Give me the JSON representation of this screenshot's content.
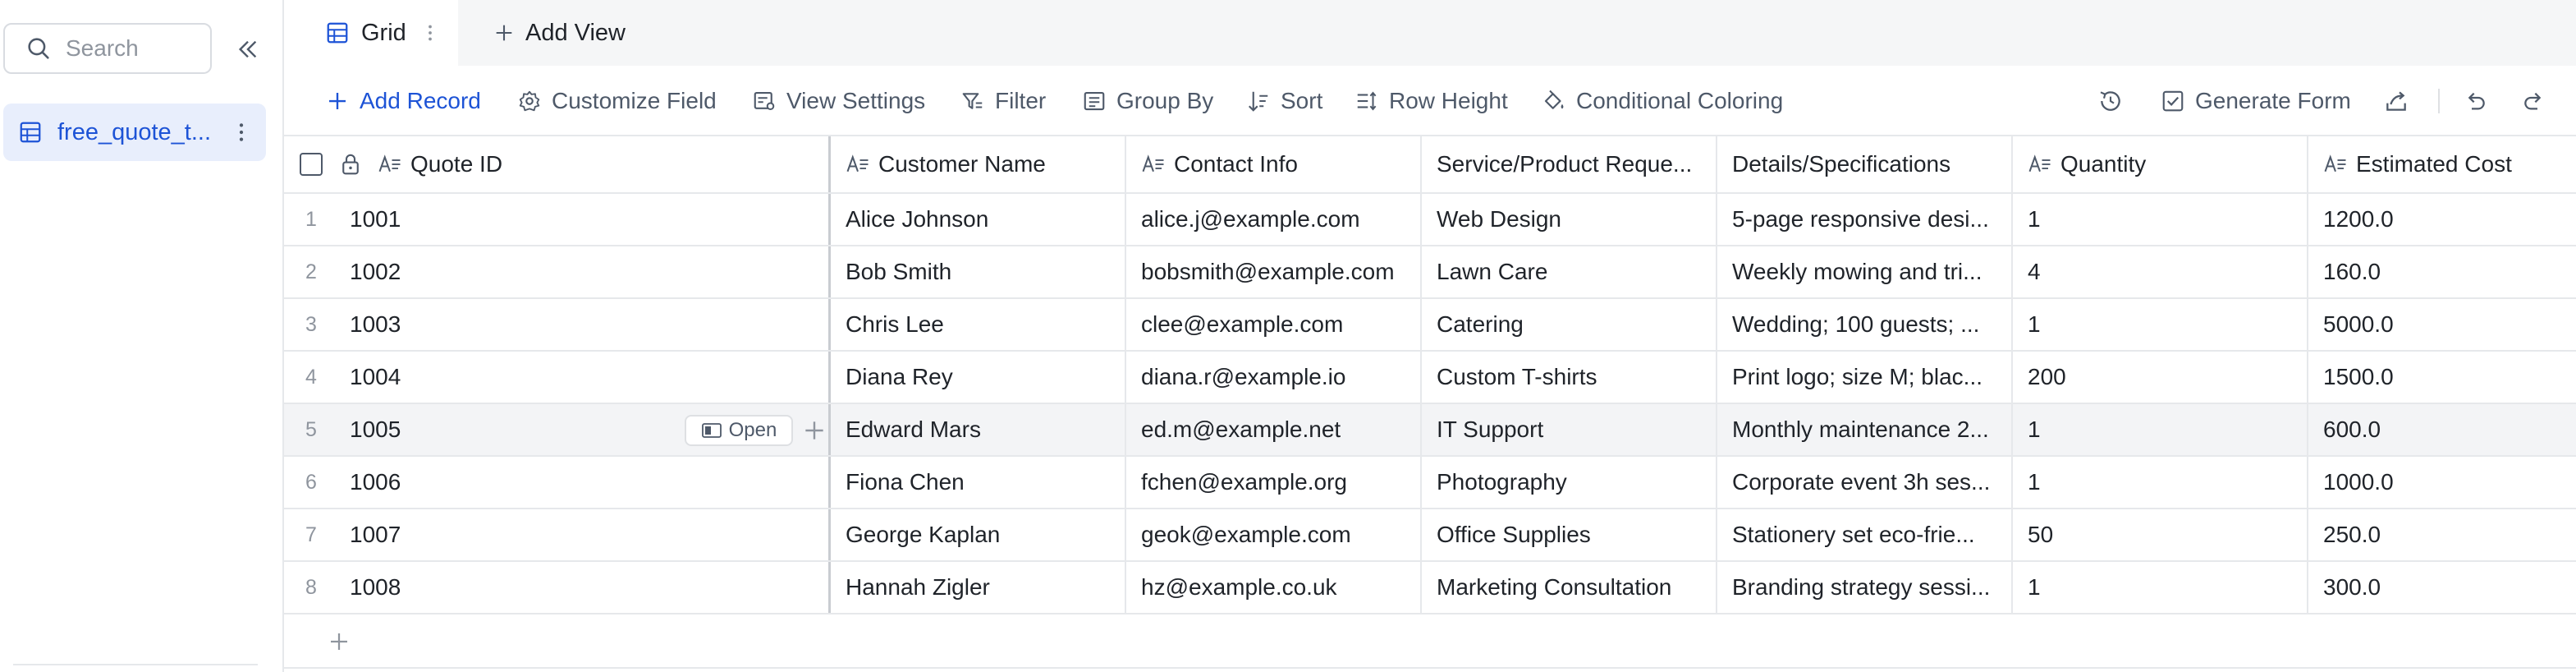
{
  "sidebar": {
    "search": {
      "placeholder": "Search",
      "value": ""
    },
    "items": [
      {
        "label": "free_quote_t..."
      }
    ]
  },
  "views": {
    "tabs": [
      {
        "label": "Grid"
      }
    ],
    "add_view_label": "Add View"
  },
  "toolbar": {
    "add_record": "Add Record",
    "customize_field": "Customize Field",
    "view_settings": "View Settings",
    "filter": "Filter",
    "group_by": "Group By",
    "sort": "Sort",
    "row_height": "Row Height",
    "conditional_coloring": "Conditional Coloring",
    "generate_form": "Generate Form"
  },
  "table": {
    "columns": [
      {
        "label": "Quote ID",
        "icon": "text-field-icon"
      },
      {
        "label": "Customer Name",
        "icon": "text-field-icon"
      },
      {
        "label": "Contact Info",
        "icon": "text-field-icon"
      },
      {
        "label": "Service/Product Reque...",
        "icon": ""
      },
      {
        "label": "Details/Specifications",
        "icon": ""
      },
      {
        "label": "Quantity",
        "icon": "text-field-icon"
      },
      {
        "label": "Estimated Cost",
        "icon": "text-field-icon"
      }
    ],
    "rows": [
      {
        "num": "1",
        "cells": [
          "1001",
          "Alice Johnson",
          "alice.j@example.com",
          "Web Design",
          "5-page responsive desi...",
          "1",
          "1200.0"
        ]
      },
      {
        "num": "2",
        "cells": [
          "1002",
          "Bob Smith",
          "bobsmith@example.com",
          "Lawn Care",
          "Weekly mowing and tri...",
          "4",
          "160.0"
        ]
      },
      {
        "num": "3",
        "cells": [
          "1003",
          "Chris Lee",
          "clee@example.com",
          "Catering",
          "Wedding; 100 guests; ...",
          "1",
          "5000.0"
        ]
      },
      {
        "num": "4",
        "cells": [
          "1004",
          "Diana Rey",
          "diana.r@example.io",
          "Custom T-shirts",
          "Print logo; size M; blac...",
          "200",
          "1500.0"
        ]
      },
      {
        "num": "5",
        "cells": [
          "1005",
          "Edward Mars",
          "ed.m@example.net",
          "IT Support",
          "Monthly maintenance 2...",
          "1",
          "600.0"
        ]
      },
      {
        "num": "6",
        "cells": [
          "1006",
          "Fiona Chen",
          "fchen@example.org",
          "Photography",
          "Corporate event 3h ses...",
          "1",
          "1000.0"
        ]
      },
      {
        "num": "7",
        "cells": [
          "1007",
          "George Kaplan",
          "geok@example.com",
          "Office Supplies",
          "Stationery set eco-frie...",
          "50",
          "250.0"
        ]
      },
      {
        "num": "8",
        "cells": [
          "1008",
          "Hannah Zigler",
          "hz@example.co.uk",
          "Marketing Consultation",
          "Branding strategy sessi...",
          "1",
          "300.0"
        ]
      }
    ],
    "hovered_row_open_label": "Open"
  },
  "colors": {
    "accent": "#1d53d6",
    "selected_item_bg": "#e8eefc",
    "grid_line": "#e6e8eb",
    "muted_text": "#8f959e"
  }
}
